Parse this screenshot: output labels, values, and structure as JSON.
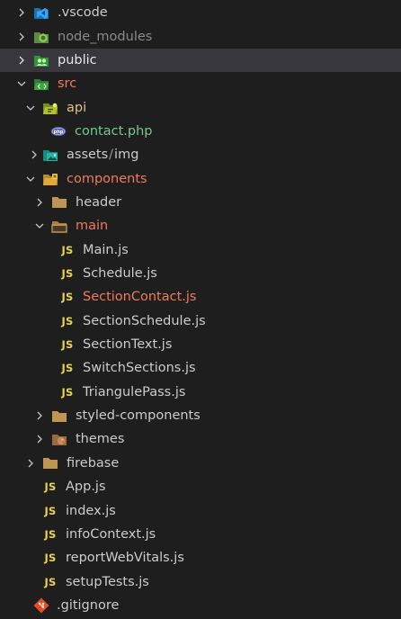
{
  "explorer": {
    "items": [
      {
        "name": ".vscode",
        "kind": "folder",
        "state": "collapsed",
        "icon": "vscode-folder-icon",
        "depth": 0
      },
      {
        "name": "node_modules",
        "kind": "folder",
        "state": "collapsed",
        "icon": "node-modules-folder-icon",
        "depth": 0,
        "dimmed": true
      },
      {
        "name": "public",
        "kind": "folder",
        "state": "collapsed",
        "icon": "public-folder-icon",
        "depth": 0,
        "selected": true
      },
      {
        "name": "src",
        "kind": "folder",
        "state": "expanded",
        "icon": "src-folder-icon",
        "depth": 0
      },
      {
        "name": "api",
        "kind": "folder",
        "state": "expanded",
        "icon": "api-folder-icon",
        "depth": 1
      },
      {
        "name": "contact.php",
        "kind": "file",
        "icon": "php-file-icon",
        "depth": 2
      },
      {
        "name_a": "assets",
        "name_sep": "/",
        "name_b": "img",
        "kind": "folder",
        "state": "collapsed",
        "icon": "images-folder-icon",
        "depth": 1
      },
      {
        "name": "components",
        "kind": "folder",
        "state": "expanded",
        "icon": "components-folder-icon",
        "depth": 1
      },
      {
        "name": "header",
        "kind": "folder",
        "state": "collapsed",
        "icon": "folder-icon",
        "depth": 2
      },
      {
        "name": "main",
        "kind": "folder",
        "state": "expanded",
        "icon": "folder-open-icon",
        "depth": 2
      },
      {
        "name": "Main.js",
        "kind": "file",
        "icon": "js-file-icon",
        "depth": 3
      },
      {
        "name": "Schedule.js",
        "kind": "file",
        "icon": "js-file-icon",
        "depth": 3
      },
      {
        "name": "SectionContact.js",
        "kind": "file",
        "icon": "js-file-icon",
        "depth": 3,
        "modified": true
      },
      {
        "name": "SectionSchedule.js",
        "kind": "file",
        "icon": "js-file-icon",
        "depth": 3
      },
      {
        "name": "SectionText.js",
        "kind": "file",
        "icon": "js-file-icon",
        "depth": 3
      },
      {
        "name": "SwitchSections.js",
        "kind": "file",
        "icon": "js-file-icon",
        "depth": 3
      },
      {
        "name": "TriangulePass.js",
        "kind": "file",
        "icon": "js-file-icon",
        "depth": 3
      },
      {
        "name": "styled-components",
        "kind": "folder",
        "state": "collapsed",
        "icon": "folder-icon",
        "depth": 2
      },
      {
        "name": "themes",
        "kind": "folder",
        "state": "collapsed",
        "icon": "themes-folder-icon",
        "depth": 2
      },
      {
        "name": "firebase",
        "kind": "folder",
        "state": "collapsed",
        "icon": "folder-icon",
        "depth": 1
      },
      {
        "name": "App.js",
        "kind": "file",
        "icon": "js-file-icon",
        "depth": 1
      },
      {
        "name": "index.js",
        "kind": "file",
        "icon": "js-file-icon",
        "depth": 1
      },
      {
        "name": "infoContext.js",
        "kind": "file",
        "icon": "js-file-icon",
        "depth": 1
      },
      {
        "name": "reportWebVitals.js",
        "kind": "file",
        "icon": "js-file-icon",
        "depth": 1
      },
      {
        "name": "setupTests.js",
        "kind": "file",
        "icon": "js-file-icon",
        "depth": 1
      },
      {
        "name": ".gitignore",
        "kind": "file",
        "icon": "git-file-icon",
        "depth": 0
      }
    ],
    "js_badge": "JS",
    "colors": {
      "background": "#1e1e1e",
      "selected_row": "#37373d",
      "text": "#cccccc",
      "dimmed_text": "#8b8b8b",
      "modified_text": "#f07a5e",
      "js_badge": "#e8d44d",
      "folder": "#c09553"
    }
  }
}
